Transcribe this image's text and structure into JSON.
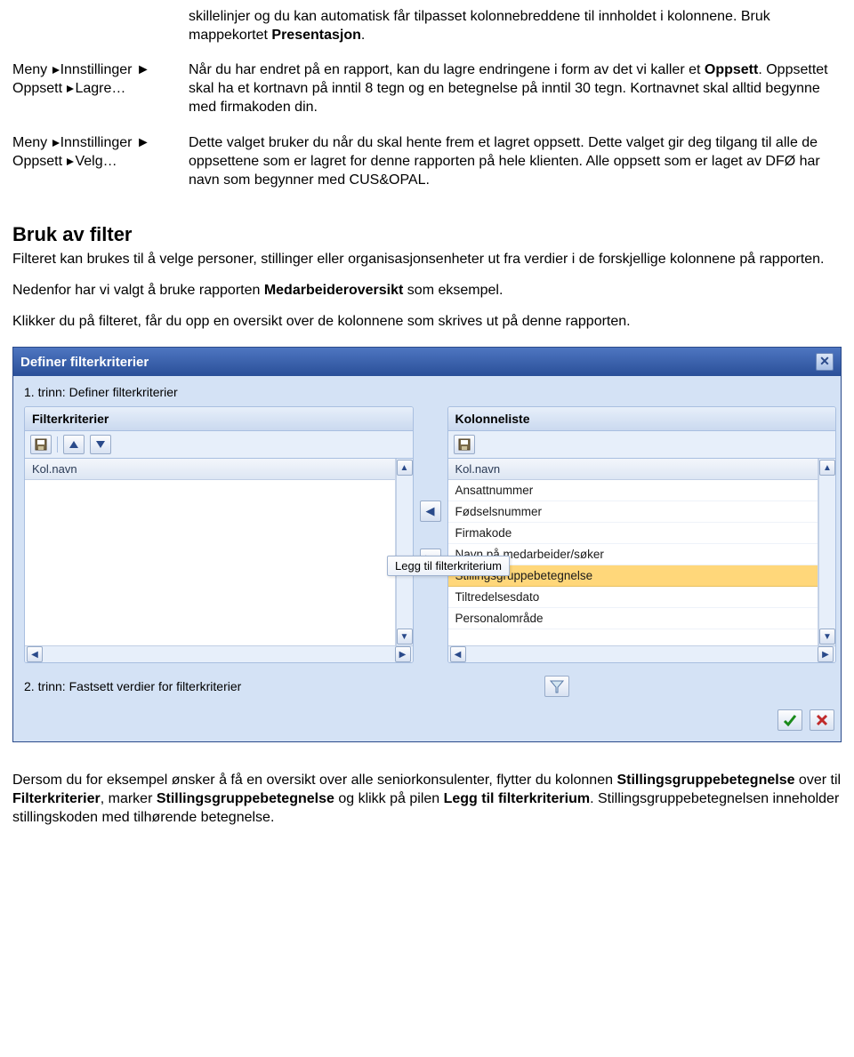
{
  "intro": {
    "text_before_bold": "skillelinjer og du kan automatisk får tilpasset kolonnebreddene til innholdet i kolonnene. Bruk mappekortet ",
    "bold": "Presentasjon",
    "text_after_bold": "."
  },
  "row1": {
    "left": {
      "line1_prefix": "Meny ",
      "line1_suffix": "Innstillinger ►",
      "line2_prefix": "Oppsett ",
      "line2_suffix": "Lagre…"
    },
    "right": {
      "t1": "Når du har endret på en rapport, kan du lagre endringene i form av det vi kaller et ",
      "b1": "Oppsett",
      "t2": ". Oppsettet skal ha et kortnavn på inntil 8 tegn og en betegnelse på inntil 30 tegn. Kortnavnet skal alltid begynne med firmakoden din."
    }
  },
  "row2": {
    "left": {
      "line1_prefix": "Meny ",
      "line1_suffix": "Innstillinger ►",
      "line2_prefix": "Oppsett ",
      "line2_suffix": "Velg…"
    },
    "right": "Dette valget bruker du når du skal hente frem et lagret oppsett. Dette valget gir deg tilgang til alle de oppsettene som er lagret for denne rapporten på hele klienten. Alle oppsett som er laget av DFØ har navn som begynner med CUS&OPAL."
  },
  "section_title": "Bruk av filter",
  "p1": "Filteret kan brukes til å velge personer, stillinger eller organisasjonsenheter ut fra verdier i de forskjellige kolonnene på rapporten.",
  "p2_a": "Nedenfor har vi valgt å bruke rapporten ",
  "p2_b": "Medarbeideroversikt",
  "p2_c": " som eksempel.",
  "p3": "Klikker du på filteret, får du opp en oversikt over de kolonnene som skrives ut på denne rapporten.",
  "dialog": {
    "title": "Definer filterkriterier",
    "step1": "1. trinn: Definer filterkriterier",
    "left_panel_title": "Filterkriterier",
    "right_panel_title": "Kolonneliste",
    "col_header": "Kol.navn",
    "right_items": [
      "Ansattnummer",
      "Fødselsnummer",
      "Firmakode",
      "Navn på medarbeider/søker",
      "Stillingsgruppebetegnelse",
      "Tiltredelsesdato",
      "Personalområde"
    ],
    "highlight_index": 4,
    "tooltip": "Legg til filterkriterium",
    "step2": "2. trinn: Fastsett verdier for filterkriterier"
  },
  "footer": {
    "t1": "Dersom du for eksempel ønsker å få en oversikt over alle seniorkonsulenter, flytter du kolonnen ",
    "b1": "Stillingsgruppebetegnelse",
    "t2": " over til ",
    "b2": "Filterkriterier",
    "t3": ", marker ",
    "b3": "Stillingsgruppebetegnelse",
    "t4": " og klikk på pilen ",
    "b4": "Legg til filterkriterium",
    "t5": ". Stillingsgruppebetegnelsen inneholder stillingskoden med tilhørende betegnelse."
  }
}
